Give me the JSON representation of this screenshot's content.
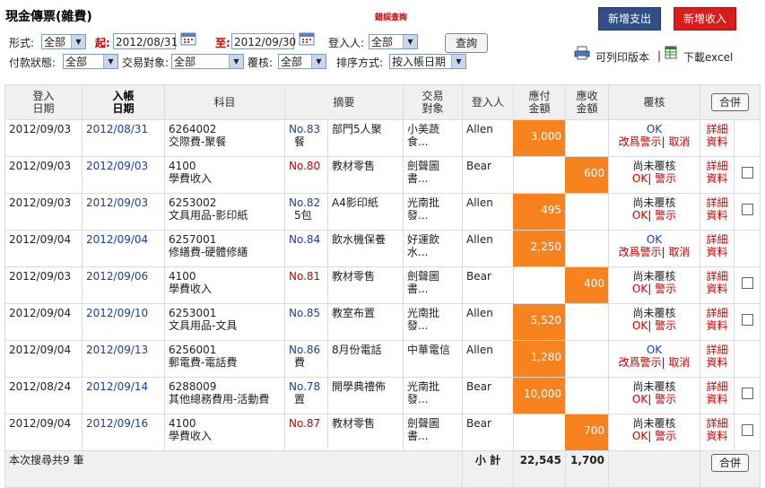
{
  "header": {
    "title": "現金傳票(雜費)",
    "error_link": "錯誤查詢",
    "add_expense": "新增支出",
    "add_income": "新增收入"
  },
  "filters": {
    "form_label": "形式:",
    "form_value": "全部",
    "start_label": "起:",
    "start_date": "2012/08/31",
    "end_label": "至:",
    "end_date": "2012/09/30",
    "registrant_label": "登入人:",
    "registrant_value": "全部",
    "query_button": "查詢",
    "pay_status_label": "付款狀態:",
    "pay_status_value": "全部",
    "counterparty_label": "交易對象:",
    "counterparty_value": "全部",
    "review_label": "覆核:",
    "review_value": "全部",
    "sort_label": "排序方式:",
    "sort_value": "按入帳日期",
    "print_version": "可列印版本",
    "separator": "|",
    "download_excel": "下載excel"
  },
  "table": {
    "headers": {
      "reg_date_1": "登入",
      "reg_date_2": "日期",
      "post_date_1": "入帳",
      "post_date_2": "日期",
      "subject": "科目",
      "summary": "摘要",
      "counterparty_1": "交易",
      "counterparty_2": "對象",
      "registrant": "登入人",
      "payable_1": "應付",
      "payable_2": "金額",
      "receivable_1": "應收",
      "receivable_2": "金額",
      "review": "覆核",
      "merge": "合併"
    },
    "rows": [
      {
        "reg": "2012/09/03",
        "post": "2012/08/31",
        "code": "6264002",
        "subject": "交際費-聚餐",
        "no": "No.83",
        "no_extra": "餐",
        "no_color": "blue",
        "summary": "部門5人聚",
        "party": "小美蔬食...",
        "user": "Allen",
        "pay": "3,000",
        "recv": "",
        "rev1": "OK",
        "rev2": "改爲警示",
        "rev_sep": "|",
        "rev3": "取消",
        "d1": "詳細",
        "d2": "資料",
        "check": false
      },
      {
        "reg": "2012/09/03",
        "post": "2012/09/03",
        "code": "4100",
        "subject": "學費收入",
        "no": "No.80",
        "no_extra": "",
        "no_color": "red",
        "summary": "教材零售",
        "party": "劍聲圖書...",
        "user": "Bear",
        "pay": "",
        "recv": "600",
        "rev1": "尚未覆核",
        "rev2": "OK",
        "rev_sep": "|",
        "rev3": "警示",
        "d1": "詳細",
        "d2": "資料",
        "check": true
      },
      {
        "reg": "2012/09/03",
        "post": "2012/09/03",
        "code": "6253002",
        "subject": "文具用品-影印紙",
        "no": "No.82",
        "no_extra": "5包",
        "no_color": "blue",
        "summary": "A4影印紙",
        "party": "光南批發...",
        "user": "Allen",
        "pay": "495",
        "recv": "",
        "rev1": "尚未覆核",
        "rev2": "OK",
        "rev_sep": "|",
        "rev3": "警示",
        "d1": "詳細",
        "d2": "資料",
        "check": true
      },
      {
        "reg": "2012/09/04",
        "post": "2012/09/04",
        "code": "6257001",
        "subject": "修繕費-硬體修繕",
        "no": "No.84",
        "no_extra": "",
        "no_color": "blue",
        "summary": "飲水機保養",
        "party": "好運飲水...",
        "user": "Allen",
        "pay": "2,250",
        "recv": "",
        "rev1": "OK",
        "rev2": "改爲警示",
        "rev_sep": "|",
        "rev3": "取消",
        "d1": "詳細",
        "d2": "資料",
        "check": false
      },
      {
        "reg": "2012/09/03",
        "post": "2012/09/06",
        "code": "4100",
        "subject": "學費收入",
        "no": "No.81",
        "no_extra": "",
        "no_color": "red",
        "summary": "教材零售",
        "party": "劍聲圖書...",
        "user": "Bear",
        "pay": "",
        "recv": "400",
        "rev1": "尚未覆核",
        "rev2": "OK",
        "rev_sep": "|",
        "rev3": "警示",
        "d1": "詳細",
        "d2": "資料",
        "check": true
      },
      {
        "reg": "2012/09/04",
        "post": "2012/09/10",
        "code": "6253001",
        "subject": "文具用品-文具",
        "no": "No.85",
        "no_extra": "",
        "no_color": "blue",
        "summary": "教室布置",
        "party": "光南批發...",
        "user": "Allen",
        "pay": "5,520",
        "recv": "",
        "rev1": "尚未覆核",
        "rev2": "OK",
        "rev_sep": "|",
        "rev3": "警示",
        "d1": "詳細",
        "d2": "資料",
        "check": true
      },
      {
        "reg": "2012/09/04",
        "post": "2012/09/13",
        "code": "6256001",
        "subject": "郵電費-電話費",
        "no": "No.86",
        "no_extra": "費",
        "no_color": "blue",
        "summary": "8月份電話",
        "party": "中華電信",
        "user": "Allen",
        "pay": "1,280",
        "recv": "",
        "rev1": "OK",
        "rev2": "改爲警示",
        "rev_sep": "|",
        "rev3": "取消",
        "d1": "詳細",
        "d2": "資料",
        "check": false
      },
      {
        "reg": "2012/08/24",
        "post": "2012/09/14",
        "code": "6288009",
        "subject": "其他總務費用-活動費",
        "no": "No.78",
        "no_extra": "置",
        "no_color": "blue",
        "summary": "開學典禮佈",
        "party": "光南批發...",
        "user": "Bear",
        "pay": "10,000",
        "recv": "",
        "rev1": "尚未覆核",
        "rev2": "OK",
        "rev_sep": "|",
        "rev3": "警示",
        "d1": "詳細",
        "d2": "資料",
        "check": true
      },
      {
        "reg": "2012/09/04",
        "post": "2012/09/16",
        "code": "4100",
        "subject": "學費收入",
        "no": "No.87",
        "no_extra": "",
        "no_color": "red",
        "summary": "教材零售",
        "party": "劍聲圖書...",
        "user": "Bear",
        "pay": "",
        "recv": "700",
        "rev1": "尚未覆核",
        "rev2": "OK",
        "rev_sep": "|",
        "rev3": "警示",
        "d1": "詳細",
        "d2": "資料",
        "check": true
      }
    ],
    "footer": {
      "count_text": "本次搜尋共9 筆",
      "subtotal_label": "小 計",
      "pay_total": "22,545",
      "recv_total": "1,700",
      "merge": "合併"
    }
  },
  "icons": {
    "calendar": "calendar-icon",
    "printer": "printer-icon",
    "excel": "excel-icon"
  },
  "colors": {
    "accent_orange": "#f7821e",
    "expense_button": "#2f4f86",
    "income_button": "#d91d1d",
    "link_blue": "#1a3ea8",
    "warn_red": "#cc0000"
  }
}
